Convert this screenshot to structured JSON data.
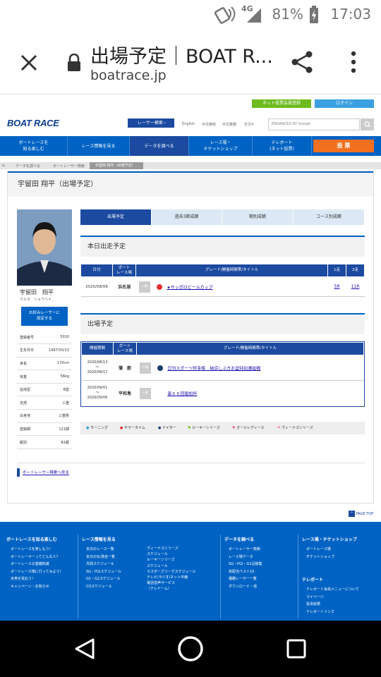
{
  "status": {
    "network": "4G",
    "battery": "81%",
    "time": "17:03"
  },
  "browser": {
    "title": "出場予定｜BOAT R...",
    "url": "boatrace.jp"
  },
  "top_links": {
    "member_register": "ネット投票会員登録",
    "login": "ログイン"
  },
  "header": {
    "logo": "BOAT RACE",
    "racer_search": "レーサー検索",
    "langs": [
      "English",
      "中文簡体",
      "中文繁體",
      "한국어"
    ],
    "search_placeholder": "ENHANCED BY Google"
  },
  "nav": [
    "ボートレースを\n知る楽しむ",
    "レース情報を見る",
    "データを調べる",
    "レース場・\nチケットショップ",
    "テレボート\n(ネット投票)",
    "投 票"
  ],
  "breadcrumb": [
    "データを調べる",
    "ボートレーサー検索",
    "宇留田 翔平（出場予定）"
  ],
  "page_title": "宇留田 翔平（出場予定）",
  "racer": {
    "name": "宇留田　翔平",
    "kana": "ウルタ　ショウヘイ",
    "fav_button": "お好みレーサーに\n設定する",
    "profile": [
      {
        "label": "登録番号",
        "value": "5010"
      },
      {
        "label": "生年月日",
        "value": "1997/03/13"
      },
      {
        "label": "身長",
        "value": "170cm"
      },
      {
        "label": "体重",
        "value": "56kg"
      },
      {
        "label": "血液型",
        "value": "B型"
      },
      {
        "label": "支部",
        "value": "三重"
      },
      {
        "label": "出身地",
        "value": "三重県"
      },
      {
        "label": "登録期",
        "value": "121期"
      },
      {
        "label": "級別",
        "value": "B1級"
      }
    ]
  },
  "tabs": [
    "出場予定",
    "過去3節成績",
    "期別成績",
    "コース別成績"
  ],
  "today": {
    "title": "本日出走予定",
    "headers": [
      "日付",
      "ボート\nレース場",
      "グレード/開催時間帯/タイトル",
      "1走",
      "2走"
    ],
    "rows": [
      {
        "date": "2020/08/06",
        "venue": "浜名湖",
        "grade": "一般",
        "title": "★サッポロビールカップ",
        "r1": "5R",
        "r2": "11R"
      }
    ]
  },
  "schedule": {
    "title": "出場予定",
    "headers": [
      "開催期間",
      "ボート\nレース場",
      "グレード/開催時間帯/タイトル"
    ],
    "rows": [
      {
        "start": "2020/08/13",
        "tilde": "〜",
        "end": "2020/08/17",
        "venue": "蒲　郡",
        "grade": "一般",
        "title": "日刊スポーツ杯争奪　納涼しぶきお盆特別選抜戦"
      },
      {
        "start": "2020/09/01",
        "tilde": "〜",
        "end": "2020/09/06",
        "venue": "平和島",
        "grade": "一般",
        "title": "第６６回報知杯"
      }
    ]
  },
  "legend": [
    "モーニング",
    "サマータイム",
    "ナイター",
    "ルーキーシリーズ",
    "オールレディース",
    "ヴィーナスシリーズ"
  ],
  "back_link": "ボートレーサー検索へ戻る",
  "page_top": "PAGE TOP",
  "footer": {
    "col1": {
      "title": "ボートレースを知る楽しむ",
      "items": [
        "ボートレースを楽しもう！",
        "ボートレーサーってどんな人？",
        "ボートレースの基礎知識",
        "ボートレース場に行ってみよう！",
        "舟券を買おう！",
        "キャンペーン・お知らせ"
      ]
    },
    "col2": {
      "title": "レース情報を見る",
      "items": [
        "本日のレース一覧",
        "本日のSL発走一覧",
        "月間スケジュール",
        "SG・PGIスケジュール",
        "G1・G2スケジュール",
        "G3スケジュール"
      ]
    },
    "col2b": {
      "items": [
        "ヴィーナスシリーズ\nスケジュール",
        "ルーキーシリーズ\nスケジュール",
        "マスターズリーグスケジュール",
        "テレビ/ラジオ/ネット中継",
        "電話音声サービス\n（テレドーム）"
      ]
    },
    "col3": {
      "title": "データを調べる",
      "items": [
        "ボートレーサー検索",
        "レース場データ",
        "SG・PGI・G1記録集",
        "高配当ベスト10",
        "優勝レーサー一覧",
        "ダウンロード・他"
      ]
    },
    "col4": {
      "title": "レース場・チケットショップ",
      "items": [
        "ボートレース場",
        "チケットショップ"
      ]
    },
    "col4b": {
      "title": "テレボート",
      "items": [
        "テレボート会員メニューについて",
        "マイページ",
        "投票結果",
        "テレボートリンク"
      ]
    }
  },
  "colors": {
    "brand_blue": "#0063c4",
    "header_navy": "#1b4aa0",
    "vote_orange": "#f07020",
    "login_blue": "#3aa0e0",
    "member_green": "#6cbb1f"
  }
}
